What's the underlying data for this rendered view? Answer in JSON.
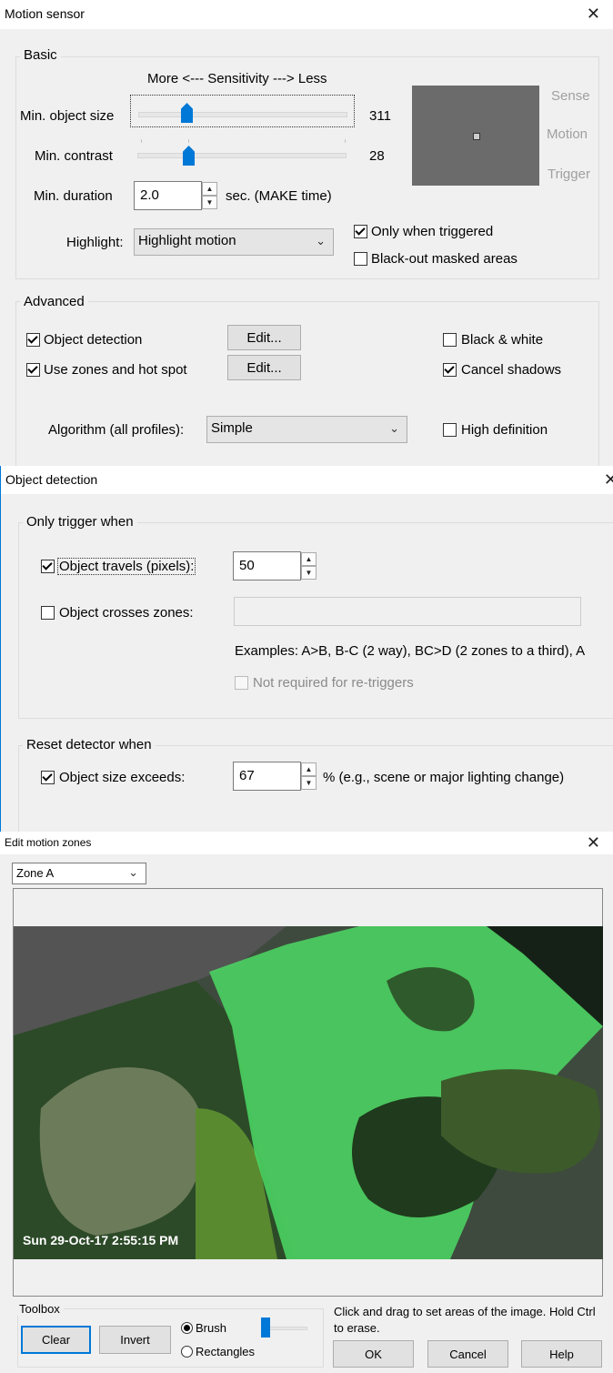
{
  "motion_sensor": {
    "title": "Motion sensor",
    "basic": {
      "group_label": "Basic",
      "sensitivity_label": "More <--- Sensitivity ---> Less",
      "min_object_size": {
        "label": "Min. object size",
        "value": "311"
      },
      "min_contrast": {
        "label": "Min. contrast",
        "value": "28"
      },
      "min_duration": {
        "label": "Min. duration",
        "value": "2.0",
        "unit": "sec.  (MAKE time)"
      },
      "highlight": {
        "label": "Highlight:",
        "selected": "Highlight motion"
      },
      "only_when_triggered": {
        "label": "Only when triggered",
        "checked": true
      },
      "black_out_masked": {
        "label": "Black-out masked areas",
        "checked": false
      },
      "preview_labels": [
        "Sense",
        "Motion",
        "Trigger"
      ]
    },
    "advanced": {
      "group_label": "Advanced",
      "object_detection": {
        "label": "Object detection",
        "checked": true,
        "edit_label": "Edit..."
      },
      "use_zones": {
        "label": "Use zones and hot spot",
        "checked": true,
        "edit_label": "Edit..."
      },
      "black_white": {
        "label": "Black & white",
        "checked": false
      },
      "cancel_shadows": {
        "label": "Cancel shadows",
        "checked": true
      },
      "algorithm": {
        "label": "Algorithm (all profiles):",
        "selected": "Simple"
      },
      "high_definition": {
        "label": "High definition",
        "checked": false
      }
    }
  },
  "object_detection": {
    "title": "Object detection",
    "only_trigger": {
      "group_label": "Only trigger when",
      "travels": {
        "label": "Object travels (pixels):",
        "checked": true,
        "value": "50"
      },
      "crosses": {
        "label": "Object crosses zones:",
        "checked": false,
        "value": ""
      },
      "examples": "Examples:  A>B, B-C (2 way), BC>D (2 zones to a third), A",
      "not_required": {
        "label": "Not required for re-triggers",
        "checked": false
      }
    },
    "reset": {
      "group_label": "Reset detector when",
      "size_exceeds": {
        "label": "Object size exceeds:",
        "checked": true,
        "value": "67",
        "suffix": "% (e.g., scene or major lighting change)"
      }
    }
  },
  "edit_zones": {
    "title": "Edit motion zones",
    "zone_select": "Zone A",
    "timestamp": "Sun 29-Oct-17  2:55:15 PM",
    "toolbox": {
      "group_label": "Toolbox",
      "clear": "Clear",
      "invert": "Invert",
      "brush": {
        "label": "Brush",
        "selected": true
      },
      "rectangles": {
        "label": "Rectangles",
        "selected": false
      }
    },
    "hint": "Click and drag to set areas of the image.  Hold Ctrl to erase.",
    "ok": "OK",
    "cancel": "Cancel",
    "help": "Help"
  },
  "colors": {
    "accent": "#0078d7",
    "zone_green": "#4cd964",
    "preview_gray": "#6b6b6b"
  }
}
